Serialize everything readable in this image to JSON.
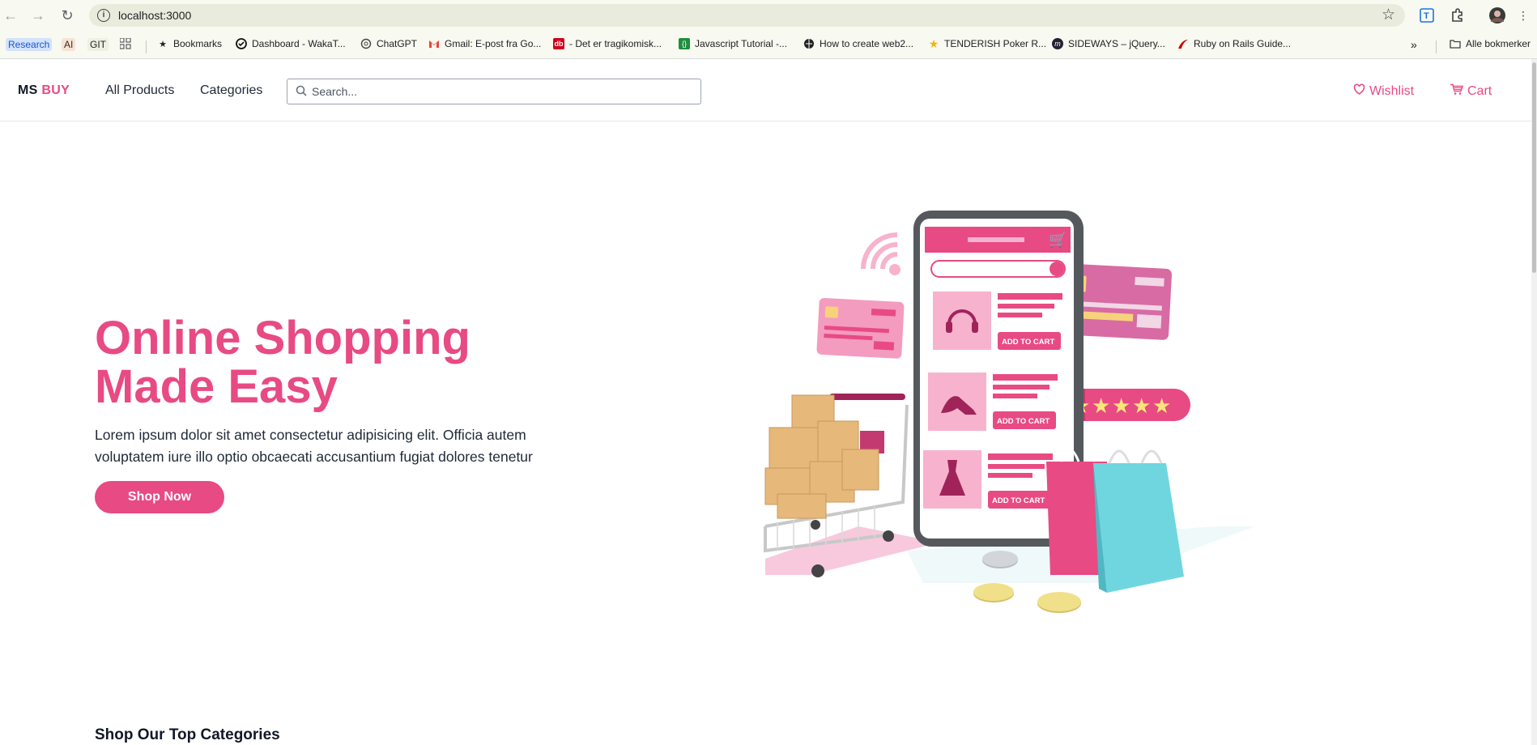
{
  "browser": {
    "url": "localhost:3000",
    "bookmarks": [
      {
        "label": "Research",
        "icon": "research-chip"
      },
      {
        "label": "AI",
        "icon": "ai-chip"
      },
      {
        "label": "GIT",
        "icon": "git-chip"
      },
      {
        "label": "",
        "icon": "apps-grid-icon"
      },
      {
        "label": "Bookmarks",
        "icon": "star-icon"
      },
      {
        "label": "Dashboard - WakaT...",
        "icon": "wakatime-icon"
      },
      {
        "label": "ChatGPT",
        "icon": "chatgpt-icon"
      },
      {
        "label": "Gmail: E-post fra Go...",
        "icon": "gmail-icon"
      },
      {
        "label": "- Det er tragikomisk...",
        "icon": "db-icon"
      },
      {
        "label": "Javascript Tutorial -...",
        "icon": "js-icon"
      },
      {
        "label": "How to create web2...",
        "icon": "globe-icon"
      },
      {
        "label": "TENDERISH Poker R...",
        "icon": "star-yellow-icon"
      },
      {
        "label": "SIDEWAYS – jQuery...",
        "icon": "m-icon"
      },
      {
        "label": "Ruby on Rails Guide...",
        "icon": "rails-icon"
      }
    ],
    "all_bookmarks": "Alle bokmerker"
  },
  "site": {
    "logo_ms": "MS",
    "logo_buy": "BUY",
    "nav": [
      "All Products",
      "Categories"
    ],
    "search_placeholder": "Search...",
    "wishlist": "Wishlist",
    "cart": "Cart"
  },
  "hero": {
    "title_line1": "Online Shopping",
    "title_line2": "Made Easy",
    "text": "Lorem ipsum dolor sit amet consectetur adipisicing elit. Officia autem voluptatem iure illo optio obcaecati accusantium fugiat dolores tenetur",
    "button": "Shop Now",
    "illustration": {
      "add_to_cart": "ADD TO CART",
      "stars": 5,
      "colors": {
        "pink": "#e84a84",
        "light_pink": "#f7b3ce",
        "teal": "#6fd6e0",
        "box": "#e6b97a",
        "purple": "#b96ab4"
      }
    }
  },
  "sections": {
    "top_categories": "Shop Our Top Categories"
  },
  "colors": {
    "accent": "#e84a84"
  }
}
